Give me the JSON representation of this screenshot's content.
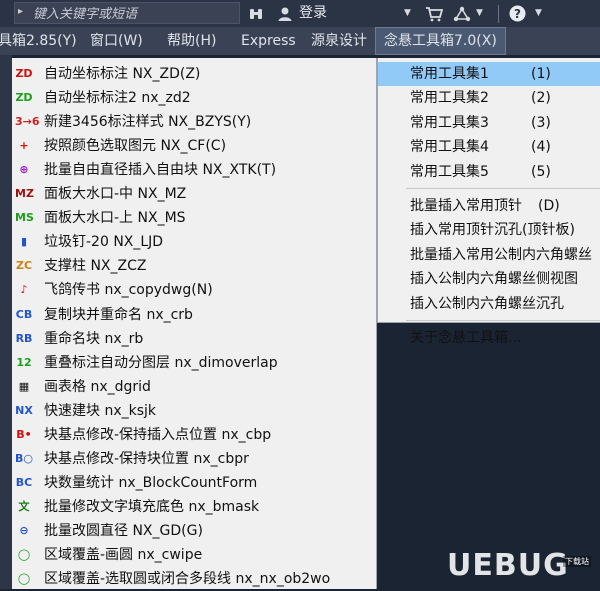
{
  "search": {
    "placeholder": "键入关键字或短语"
  },
  "topbar": {
    "login": "登录",
    "icons": [
      "binoculars-icon",
      "user-icon",
      "cart-icon",
      "network-icon",
      "help-icon"
    ]
  },
  "menubar": {
    "items": [
      "具箱2.85(Y)",
      "窗口(W)",
      "帮助(H)",
      "Express",
      "源泉设计",
      "念悬工具箱7.0(X)"
    ]
  },
  "left_menu": {
    "items": [
      {
        "icon": "ZD",
        "icon_color": "#d01010",
        "label": "自动坐标标注  NX_ZD(Z)"
      },
      {
        "icon": "ZD",
        "icon_color": "#1aa01a",
        "label": "自动坐标标注2  nx_zd2"
      },
      {
        "icon": "3→6",
        "icon_color": "#cc2222",
        "label": "新建3456标注样式  NX_BZYS(Y)"
      },
      {
        "icon": "+",
        "icon_color": "#d01010",
        "label": "按照颜色选取图元  NX_CF(C)"
      },
      {
        "icon": "⊕",
        "icon_color": "#9b1ec9",
        "label": "批量自由直径插入自由块  NX_XTK(T)"
      },
      {
        "icon": "MZ",
        "icon_color": "#a01010",
        "label": "面板大水口-中  NX_MZ"
      },
      {
        "icon": "MS",
        "icon_color": "#1aa01a",
        "label": "面板大水口-上  NX_MS"
      },
      {
        "icon": "▮",
        "icon_color": "#2255cc",
        "label": "垃圾钉-20  NX_LJD"
      },
      {
        "icon": "ZC",
        "icon_color": "#d08010",
        "label": "支撑柱  NX_ZCZ"
      },
      {
        "icon": "♪",
        "icon_color": "#d01010",
        "label": "飞鸽传书  nx_copydwg(N)"
      },
      {
        "icon": "CB",
        "icon_color": "#2255cc",
        "label": "复制块并重命名  nx_crb"
      },
      {
        "icon": "RB",
        "icon_color": "#2255cc",
        "label": "重命名块  nx_rb"
      },
      {
        "icon": "12",
        "icon_color": "#1aa01a",
        "label": "重叠标注自动分图层  nx_dimoverlap"
      },
      {
        "icon": "▦",
        "icon_color": "#111111",
        "label": "画表格  nx_dgrid"
      },
      {
        "icon": "NX",
        "icon_color": "#2255cc",
        "label": "快速建块  nx_ksjk"
      },
      {
        "icon": "B•",
        "icon_color": "#d01010",
        "label": "块基点修改-保持插入点位置  nx_cbp"
      },
      {
        "icon": "B○",
        "icon_color": "#2255cc",
        "label": "块基点修改-保持块位置  nx_cbpr"
      },
      {
        "icon": "BC",
        "icon_color": "#2255cc",
        "label": "块数量统计  nx_BlockCountForm"
      },
      {
        "icon": "文",
        "icon_color": "#1a7f1a",
        "label": "批量修改文字填充底色  nx_bmask"
      },
      {
        "icon": "⊖",
        "icon_color": "#2255cc",
        "label": "批量改圆直径  NX_GD(G)"
      },
      {
        "icon": "◯",
        "icon_color": "#1aa01a",
        "label": "区域覆盖-画圆  nx_cwipe"
      },
      {
        "icon": "◯",
        "icon_color": "#1aa01a",
        "label": "区域覆盖-选取圆或闭合多段线  nx_nx_ob2wo"
      }
    ]
  },
  "right_menu": {
    "groups": [
      [
        {
          "label": "常用工具集1",
          "accel": "(1)",
          "highlighted": true
        },
        {
          "label": "常用工具集2",
          "accel": "(2)"
        },
        {
          "label": "常用工具集3",
          "accel": "(3)"
        },
        {
          "label": "常用工具集4",
          "accel": "(4)"
        },
        {
          "label": "常用工具集5",
          "accel": "(5)"
        }
      ],
      [
        {
          "label": "批量插入常用顶针",
          "accel": "(D)"
        },
        {
          "label": "插入常用顶针沉孔(顶针板)",
          "accel": ""
        },
        {
          "label": "批量插入常用公制内六角螺丝",
          "accel": ""
        },
        {
          "label": "插入公制内六角螺丝侧视图",
          "accel": ""
        },
        {
          "label": "插入公制内六角螺丝沉孔",
          "accel": ""
        }
      ],
      [
        {
          "label": "关于念悬工具箱...",
          "accel": ""
        }
      ]
    ]
  },
  "watermark": {
    "text": "UEBUG",
    "small": "下载站"
  }
}
